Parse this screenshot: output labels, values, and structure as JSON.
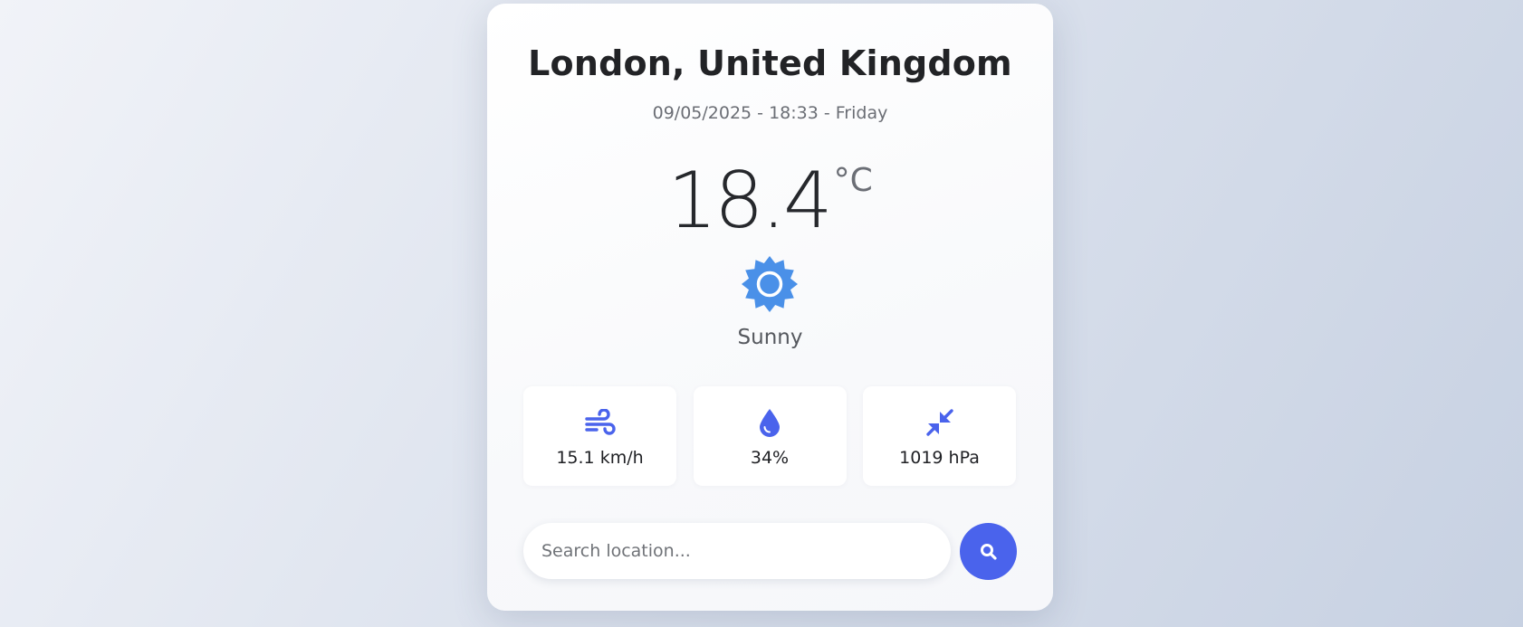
{
  "weather": {
    "location": "London, United Kingdom",
    "datetime": "09/05/2025 - 18:33 - Friday",
    "temperature": "18.4",
    "unit": "°C",
    "condition": "Sunny",
    "condition_icon": "sun-icon"
  },
  "stats": [
    {
      "icon": "wind-icon",
      "value": "15.1 km/h"
    },
    {
      "icon": "humidity-drop-icon",
      "value": "34%"
    },
    {
      "icon": "pressure-compress-icon",
      "value": "1019 hPa"
    }
  ],
  "search": {
    "placeholder": "Search location...",
    "value": "",
    "button_icon": "search-icon"
  },
  "colors": {
    "accent": "#4a63ec",
    "sun": "#4a90e8",
    "text_dark": "#222326",
    "text_muted": "#6b6e75"
  }
}
